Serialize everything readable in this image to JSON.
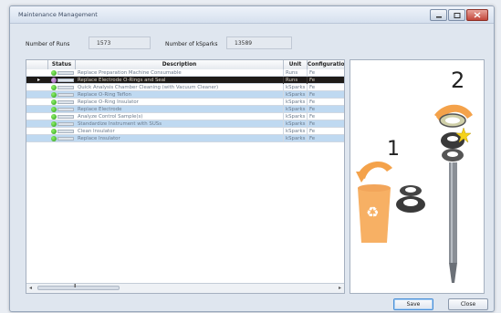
{
  "window": {
    "title": "Maintenance Management"
  },
  "fields": {
    "runs_label": "Number of Runs",
    "runs_value": "1573",
    "ksparks_label": "Number of kSparks",
    "ksparks_value": "13589"
  },
  "grid": {
    "columns": [
      "Status",
      "Description",
      "Unit",
      "Configuration"
    ],
    "rows": [
      {
        "description": "Replace Preparation Machine Consumable",
        "unit": "Runs",
        "config": "Fe",
        "style": "white",
        "status": "green"
      },
      {
        "description": "Replace Electrode O-Rings and Seal",
        "unit": "Runs",
        "config": "Fe",
        "style": "selected",
        "status": "purple"
      },
      {
        "description": "Quick Analysis Chamber Cleaning (with Vacuum Cleaner)",
        "unit": "kSparks",
        "config": "Fe",
        "style": "white",
        "status": "green"
      },
      {
        "description": "Replace O-Ring Teflon",
        "unit": "kSparks",
        "config": "Fe",
        "style": "blue",
        "status": "green"
      },
      {
        "description": "Replace O-Ring Insulator",
        "unit": "kSparks",
        "config": "Fe",
        "style": "white",
        "status": "green"
      },
      {
        "description": "Replace Electrode",
        "unit": "kSparks",
        "config": "Fe",
        "style": "blue",
        "status": "green"
      },
      {
        "description": "Analyze Control Sample(s)",
        "unit": "kSparks",
        "config": "Fe",
        "style": "white",
        "status": "green"
      },
      {
        "description": "Standardize Instrument with SUSs",
        "unit": "kSparks",
        "config": "Fe",
        "style": "blue",
        "status": "green"
      },
      {
        "description": "Clean Insulator",
        "unit": "kSparks",
        "config": "Fe",
        "style": "white",
        "status": "green"
      },
      {
        "description": "Replace Insulator",
        "unit": "kSparks",
        "config": "Fe",
        "style": "blue",
        "status": "green"
      }
    ],
    "scroll_grip": "III"
  },
  "illustration": {
    "step1": "1",
    "step2": "2"
  },
  "buttons": {
    "save": "Save",
    "close": "Close"
  },
  "colors": {
    "accent_blue": "#bfd9f1",
    "selected_row": "#1e1b18",
    "status_green": "#2c9d17",
    "bin_orange": "#f2a55a",
    "arrow_orange": "#f4a24a",
    "star_yellow": "#f5d21a"
  },
  "icons": {
    "recycle": "recycle-icon",
    "minimize": "minimize-icon",
    "maximize": "maximize-icon",
    "close": "close-icon"
  }
}
